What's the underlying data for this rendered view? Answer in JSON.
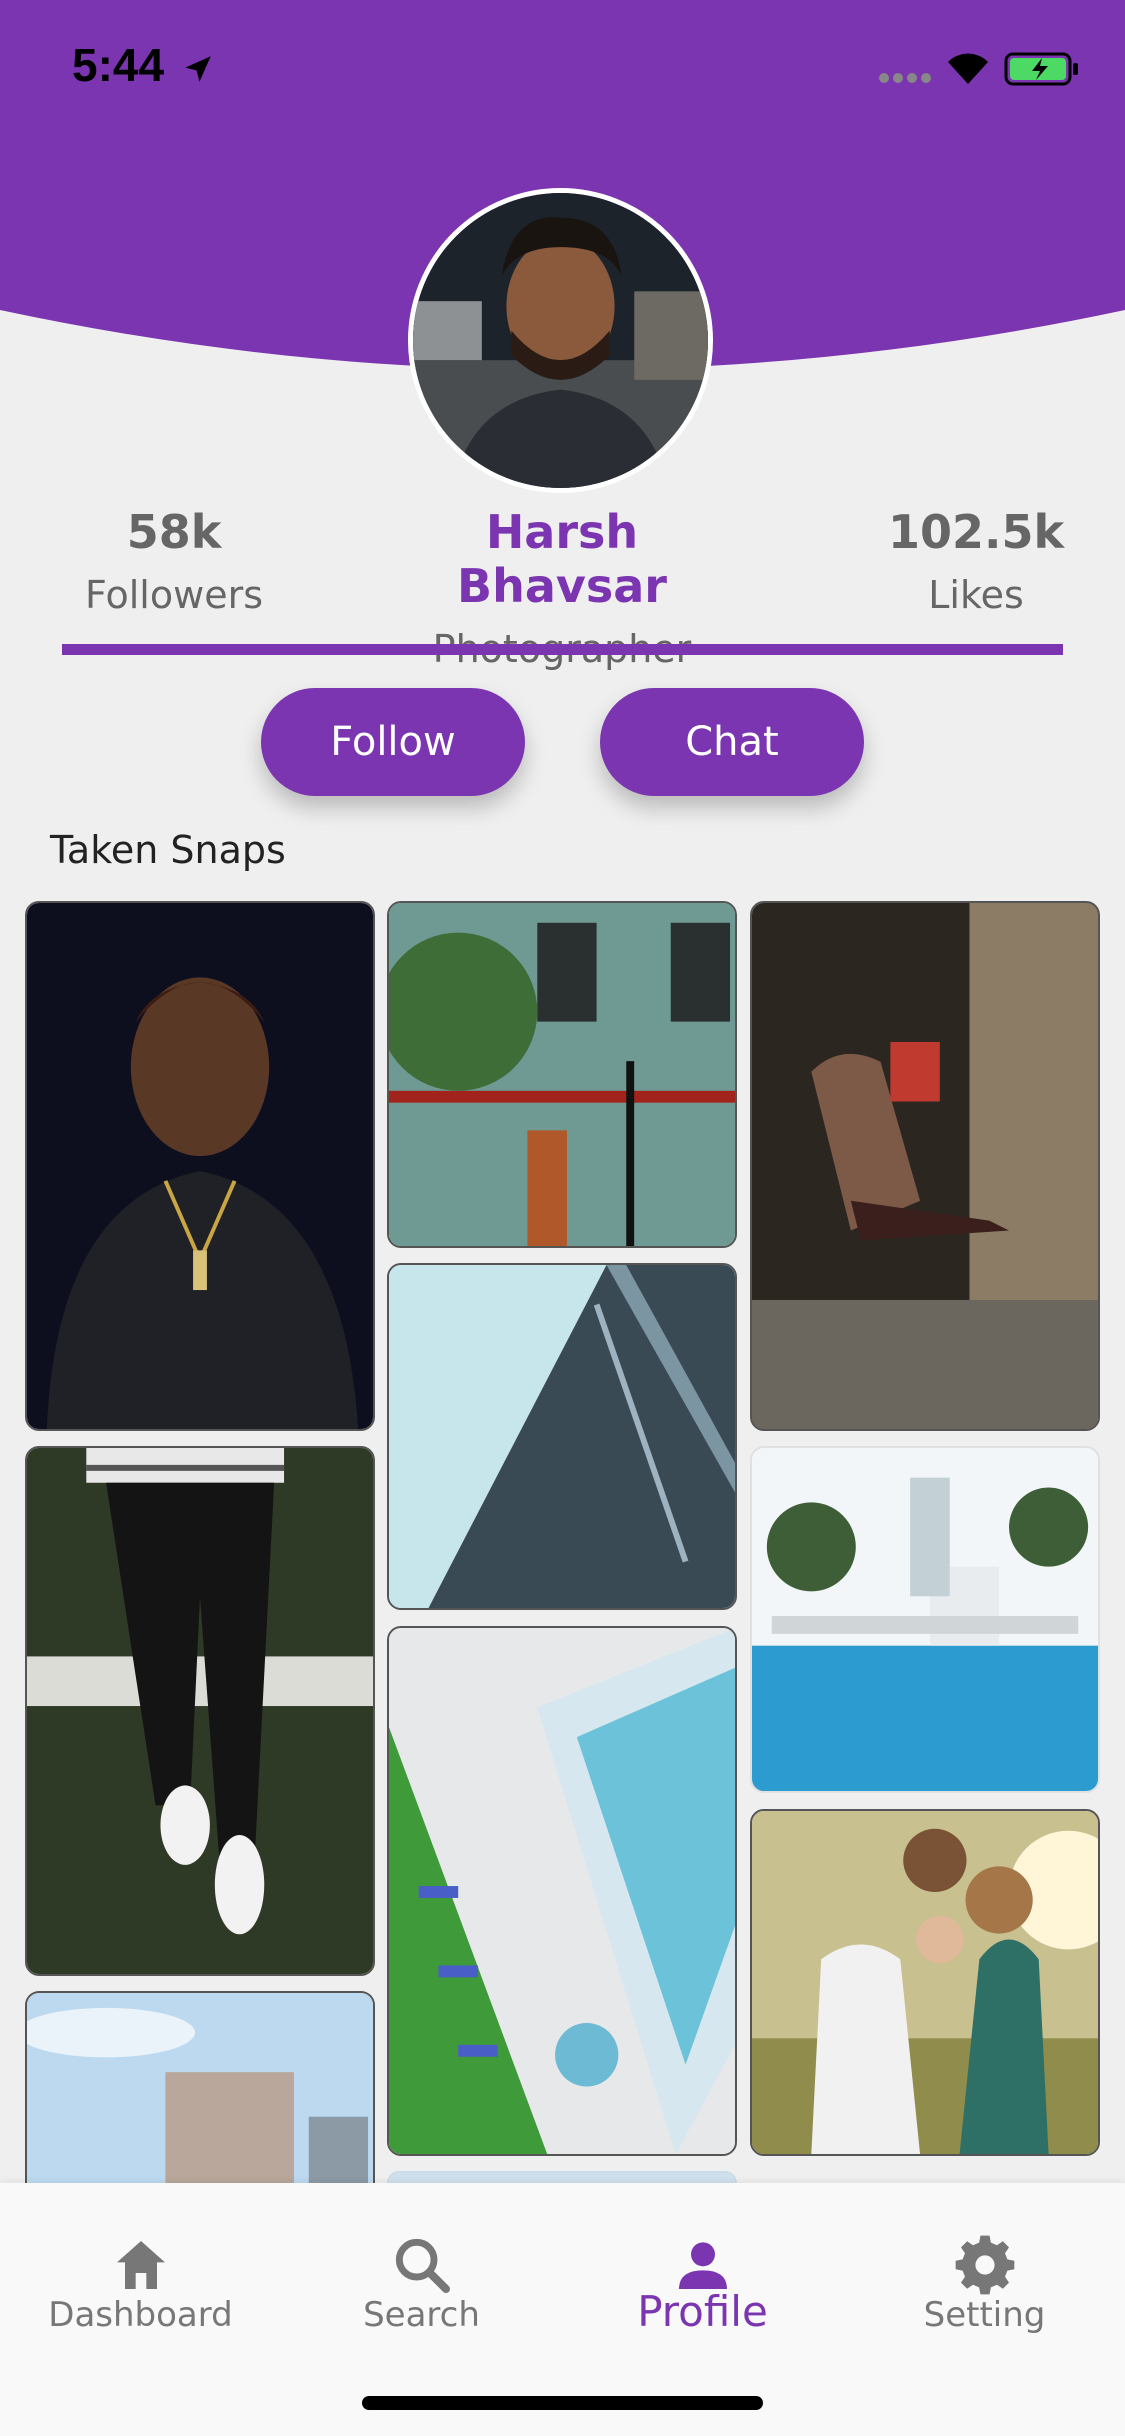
{
  "status_bar": {
    "time": "5:44"
  },
  "profile": {
    "name": "Harsh Bhavsar",
    "role": "Photographer",
    "followers_value": "58k",
    "followers_label": "Followers",
    "likes_value": "102.5k",
    "likes_label": "Likes"
  },
  "actions": {
    "follow_label": "Follow",
    "chat_label": "Chat"
  },
  "section": {
    "title": "Taken Snaps"
  },
  "tabs": [
    {
      "label": "Dashboard",
      "icon": "home-icon"
    },
    {
      "label": "Search",
      "icon": "search-icon"
    },
    {
      "label": "Profile",
      "icon": "person-icon"
    },
    {
      "label": "Setting",
      "icon": "gear-icon"
    }
  ],
  "colors": {
    "accent": "#7b35b0",
    "background": "#efefef"
  }
}
